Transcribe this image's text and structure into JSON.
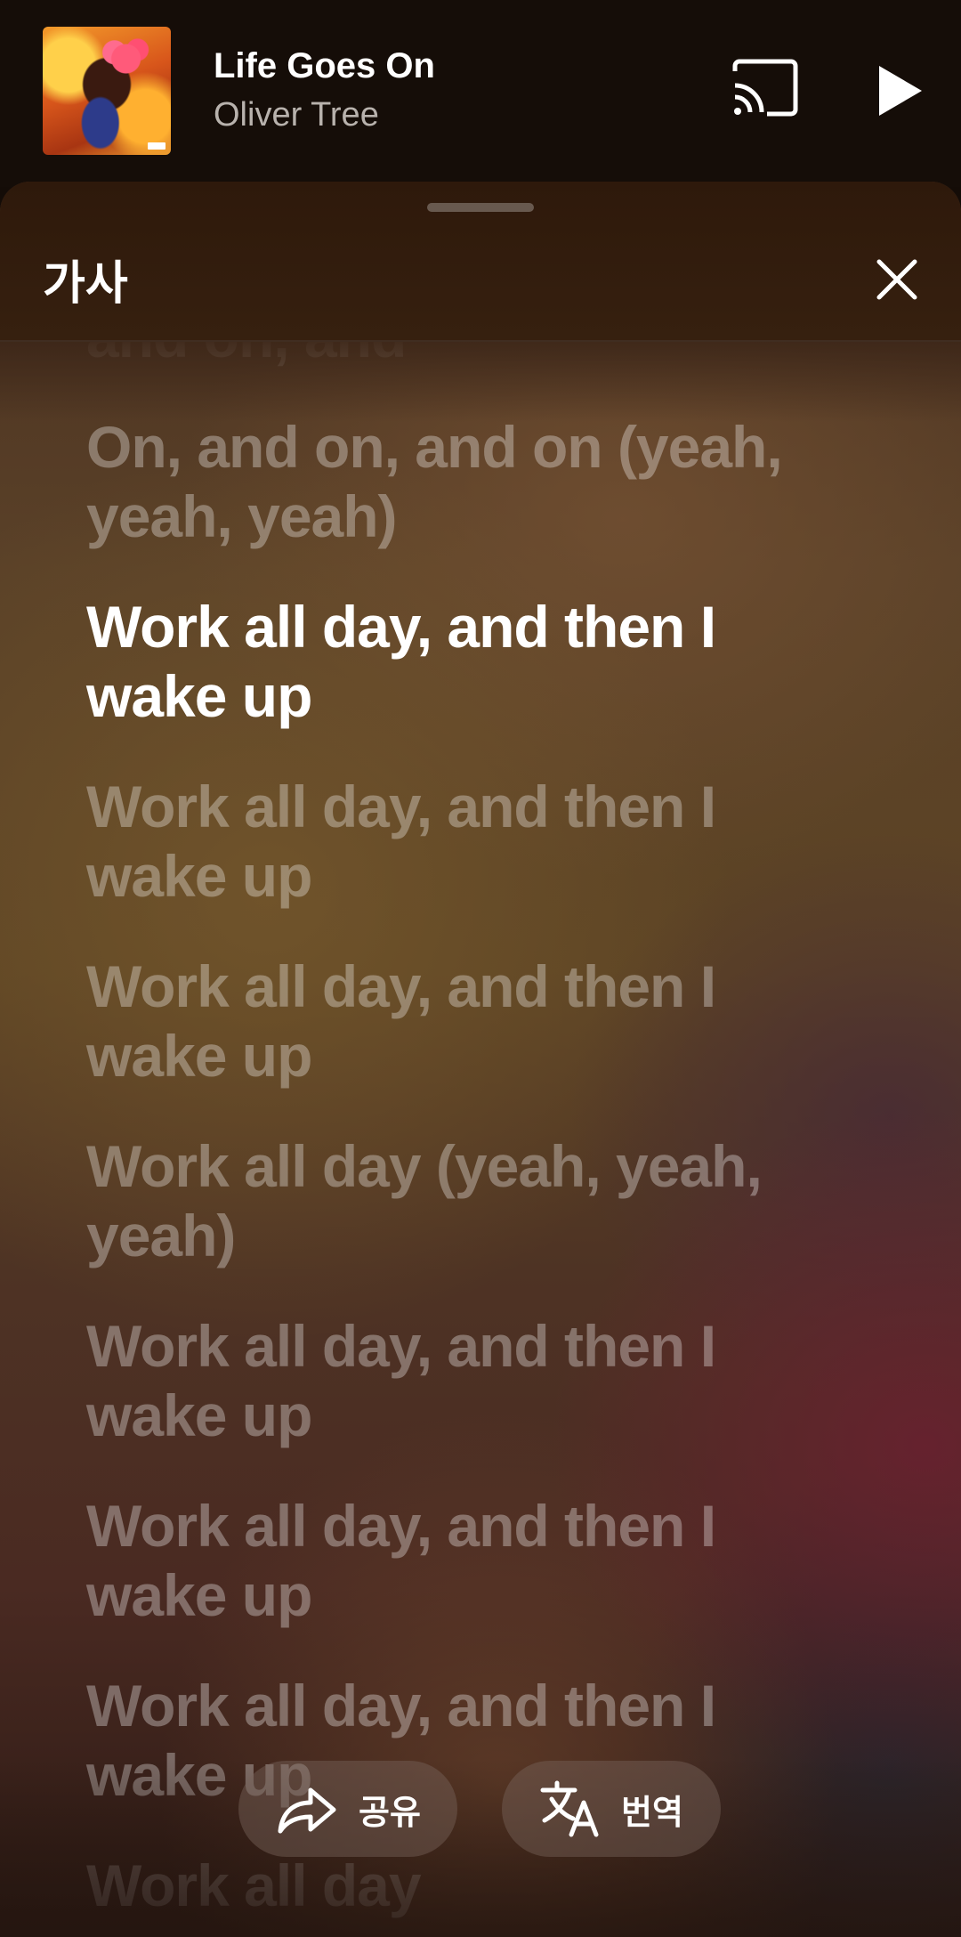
{
  "mini_player": {
    "song_title": "Life Goes On",
    "artist": "Oliver Tree",
    "album_art_icon": "album-cover-image",
    "cast_icon": "cast-icon",
    "play_icon": "play-icon"
  },
  "lyrics_sheet": {
    "title": "가사",
    "close_icon": "close-icon",
    "lines": [
      "and on, and",
      "On, and on, and on (yeah, yeah, yeah)",
      "Work all day, and then I wake up",
      "Work all day, and then I wake up",
      "Work all day, and then I wake up",
      "Work all day (yeah, yeah, yeah)",
      "Work all day, and then I wake up",
      "Work all day, and then I wake up",
      "Work all day, and then I wake up",
      "Work all day"
    ],
    "active_line_index": 2
  },
  "actions": {
    "share_label": "공유",
    "share_icon": "share-icon",
    "translate_label": "번역",
    "translate_icon": "translate-icon"
  },
  "colors": {
    "active_lyric": "#ffffff",
    "inactive_lyric": "rgba(255,255,255,0.32)",
    "header_bg": "#150d08"
  }
}
